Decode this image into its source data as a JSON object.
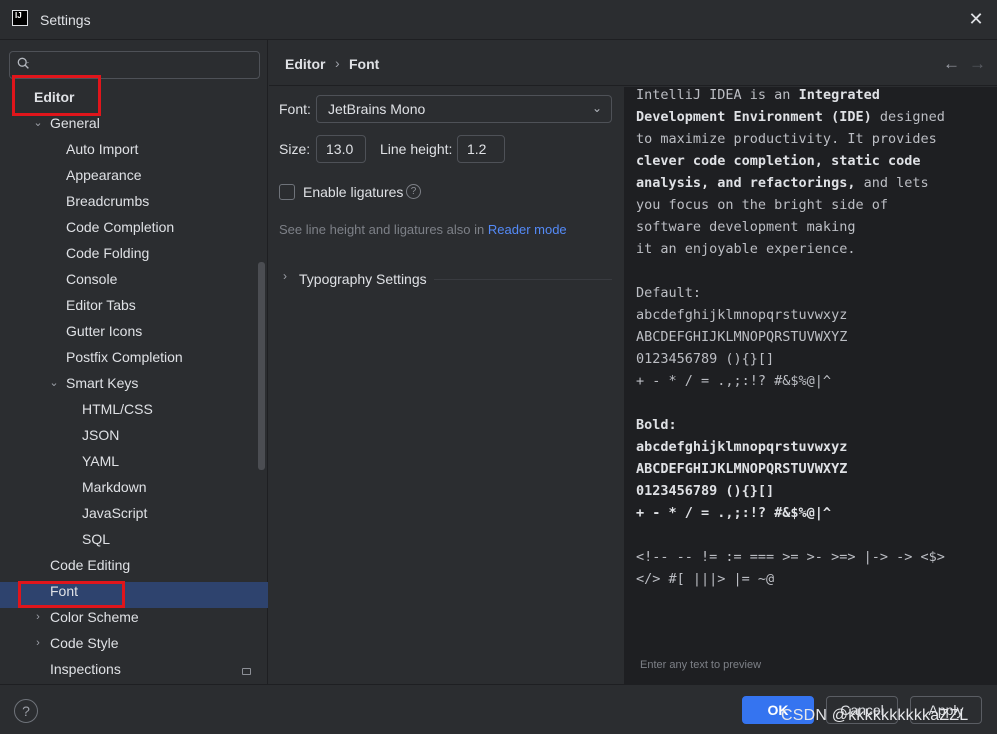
{
  "window": {
    "title": "Settings",
    "app_icon_text": "IJ"
  },
  "sidebar": {
    "search_placeholder": "",
    "items": [
      {
        "label": "Editor"
      },
      {
        "label": "General"
      },
      {
        "label": "Auto Import"
      },
      {
        "label": "Appearance"
      },
      {
        "label": "Breadcrumbs"
      },
      {
        "label": "Code Completion"
      },
      {
        "label": "Code Folding"
      },
      {
        "label": "Console"
      },
      {
        "label": "Editor Tabs"
      },
      {
        "label": "Gutter Icons"
      },
      {
        "label": "Postfix Completion"
      },
      {
        "label": "Smart Keys"
      },
      {
        "label": "HTML/CSS"
      },
      {
        "label": "JSON"
      },
      {
        "label": "YAML"
      },
      {
        "label": "Markdown"
      },
      {
        "label": "JavaScript"
      },
      {
        "label": "SQL"
      },
      {
        "label": "Code Editing"
      },
      {
        "label": "Font"
      },
      {
        "label": "Color Scheme"
      },
      {
        "label": "Code Style"
      },
      {
        "label": "Inspections"
      }
    ]
  },
  "header": {
    "breadcrumb_parent": "Editor",
    "breadcrumb_current": "Font"
  },
  "form": {
    "font_label": "Font:",
    "font_value": "JetBrains Mono",
    "size_label": "Size:",
    "size_value": "13.0",
    "line_height_label": "Line height:",
    "line_height_value": "1.2",
    "ligatures_label": "Enable ligatures",
    "ligatures_checked": false,
    "hint_text": "See line height and ligatures also in",
    "hint_link": "Reader mode",
    "typography_label": "Typography Settings"
  },
  "preview": {
    "hint": "Enter any text to preview",
    "lines": {
      "l1a": "IntelliJ IDEA is an ",
      "l1b": "Integrated",
      "l2a": "Development Environment (IDE)",
      "l2b": " designed",
      "l3": "to maximize productivity. It provides",
      "l4": "clever code completion, static code",
      "l5a": "analysis, and refactorings,",
      "l5b": " and lets",
      "l6": "you focus on the bright side of",
      "l7": "software development making",
      "l8": "it an enjoyable experience.",
      "default_title": "Default:",
      "lower": "abcdefghijklmnopqrstuvwxyz",
      "upper": "ABCDEFGHIJKLMNOPQRSTUVWXYZ",
      "digits": "0123456789 (){}[]",
      "symbols": "+ - * / = .,;:!? #&$%@|^",
      "bold_title": "Bold:",
      "ligs1": "<!-- -- != := === >= >- >=> |-> -> <$>",
      "ligs2": "</> #[ |||> |= ~@"
    }
  },
  "footer": {
    "ok": "OK",
    "cancel": "Cancel",
    "apply": "Apply",
    "watermark": "CSDN @kkkkkkkkkkaZZL"
  },
  "colors": {
    "background": "#2b2d30",
    "selection": "#2e436e",
    "accent": "#3574f0",
    "link": "#548af7",
    "highlight_box": "#e0151b"
  }
}
